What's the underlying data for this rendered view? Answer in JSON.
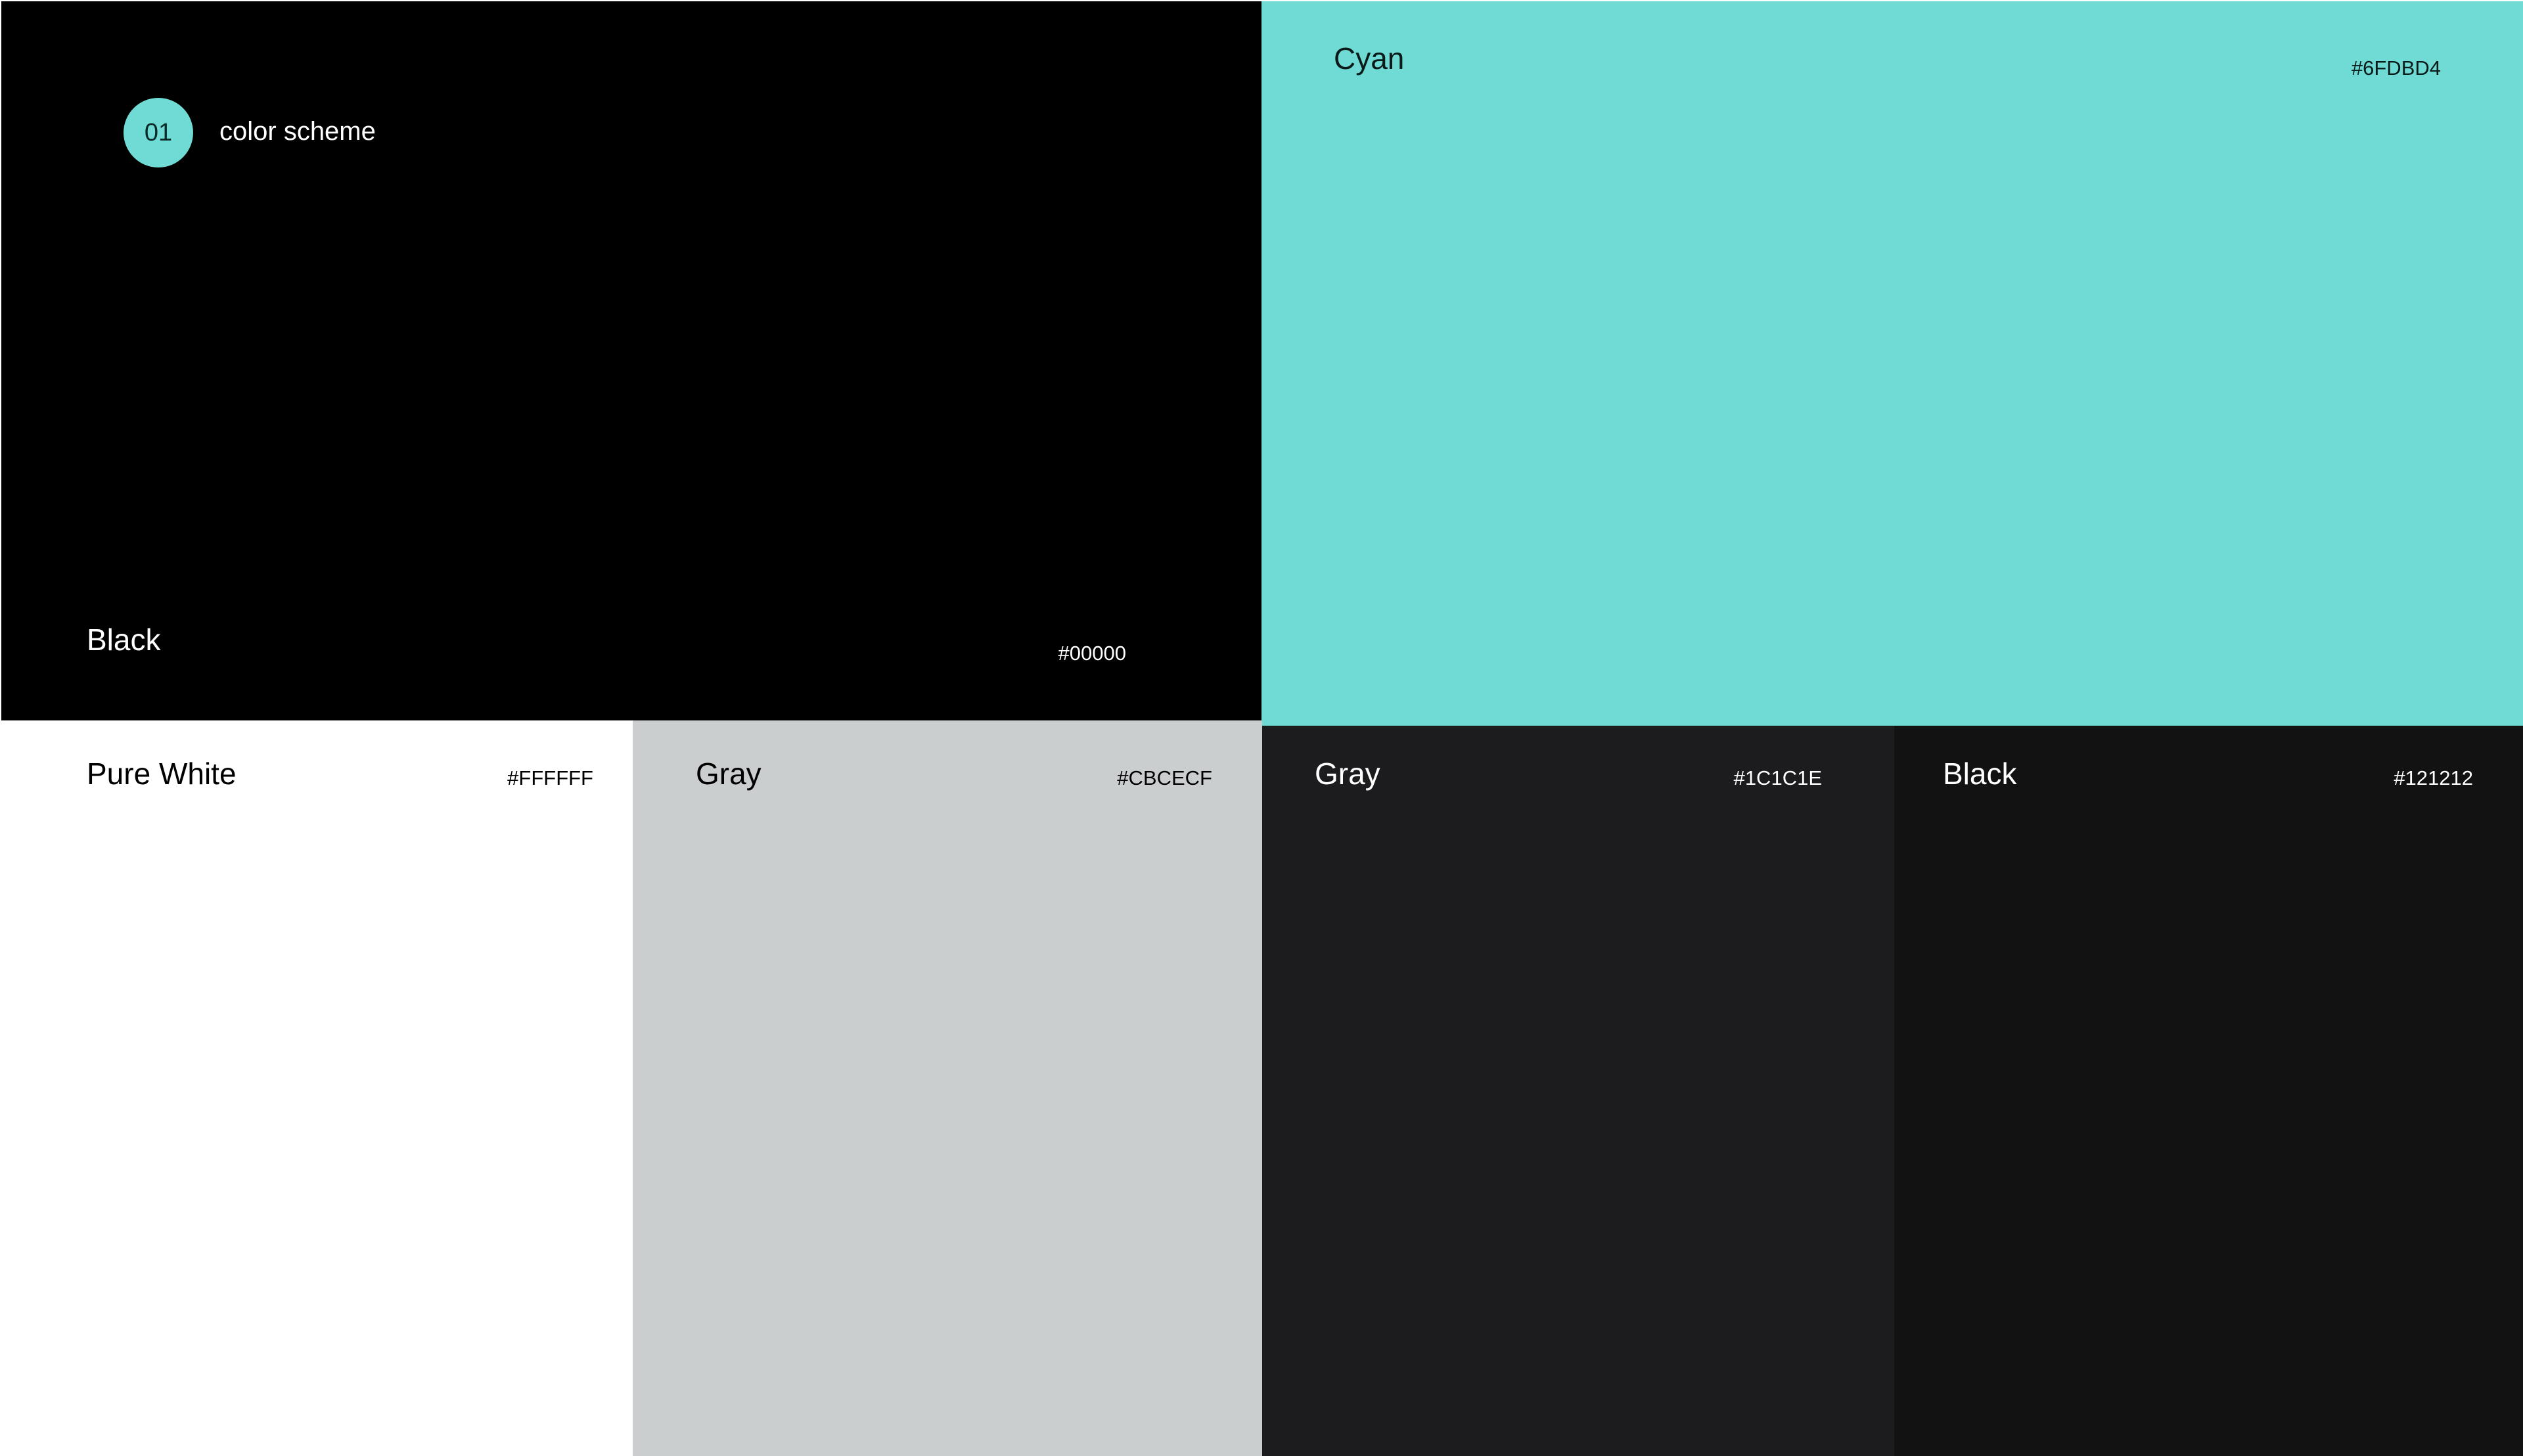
{
  "header": {
    "badge_number": "01",
    "title": "color scheme"
  },
  "swatches": [
    {
      "id": "black-main",
      "name": "Black",
      "hex": "#00000",
      "color": "#000000"
    },
    {
      "id": "cyan",
      "name": "Cyan",
      "hex": "#6FDBD4",
      "color": "#6FDBD4"
    },
    {
      "id": "white",
      "name": "Pure White",
      "hex": "#FFFFFF",
      "color": "#FFFFFF"
    },
    {
      "id": "gray-light",
      "name": "Gray",
      "hex": "#CBCECF",
      "color": "#CBCECF"
    },
    {
      "id": "gray-dark",
      "name": "Gray",
      "hex": "#1C1C1E",
      "color": "#1C1C1E"
    },
    {
      "id": "black-soft",
      "name": "Black",
      "hex": "#121212",
      "color": "#121212"
    }
  ]
}
